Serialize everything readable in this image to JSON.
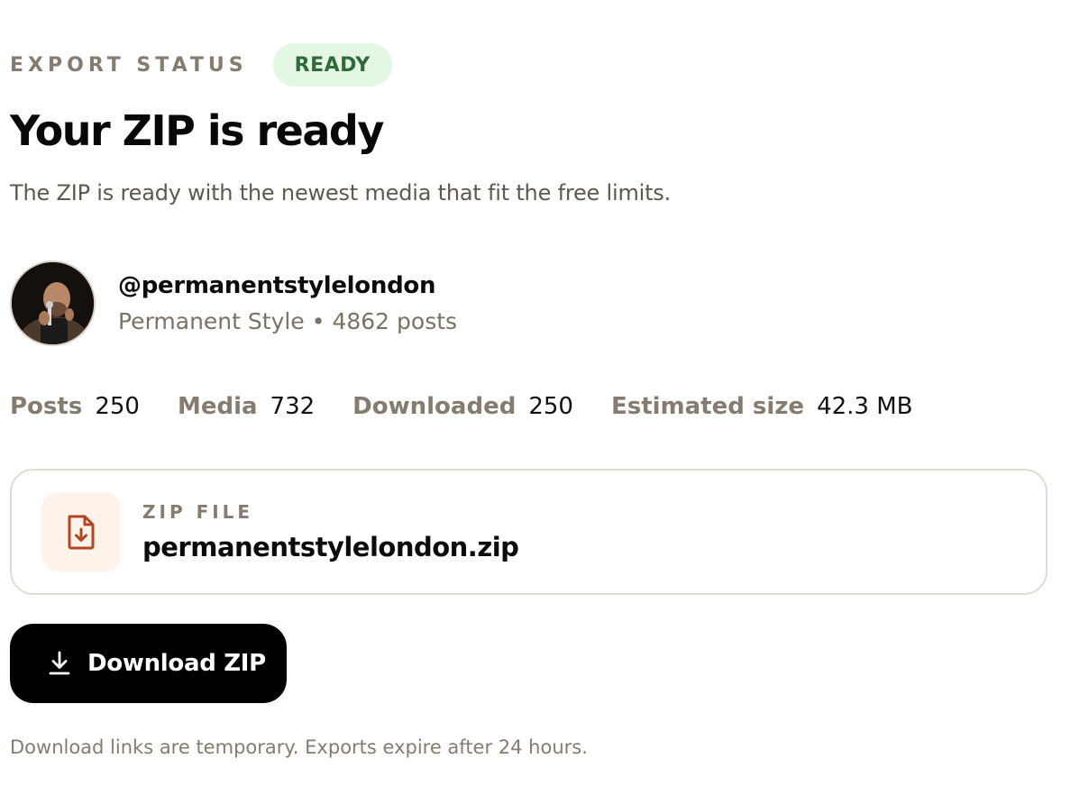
{
  "header": {
    "eyebrow": "EXPORT STATUS",
    "badge": "READY",
    "title": "Your ZIP is ready",
    "subtitle": "The ZIP is ready with the newest media that fit the free limits."
  },
  "profile": {
    "handle": "@permanentstylelondon",
    "name": "Permanent Style",
    "separator": "•",
    "posts": "4862 posts"
  },
  "stats": [
    {
      "label": "Posts",
      "value": "250"
    },
    {
      "label": "Media",
      "value": "732"
    },
    {
      "label": "Downloaded",
      "value": "250"
    },
    {
      "label": "Estimated size",
      "value": "42.3 MB"
    }
  ],
  "file": {
    "label": "ZIP FILE",
    "name": "permanentstylelondon.zip",
    "icon": "file-download-icon"
  },
  "actions": {
    "download_label": "Download ZIP",
    "download_icon": "download-icon"
  },
  "footnote": "Download links are temporary. Exports expire after 24 hours.",
  "colors": {
    "badge_bg": "#e3f7e4",
    "badge_text": "#2f6b37",
    "muted": "#857c6f",
    "file_icon": "#b5441f",
    "button_bg": "#000000"
  }
}
